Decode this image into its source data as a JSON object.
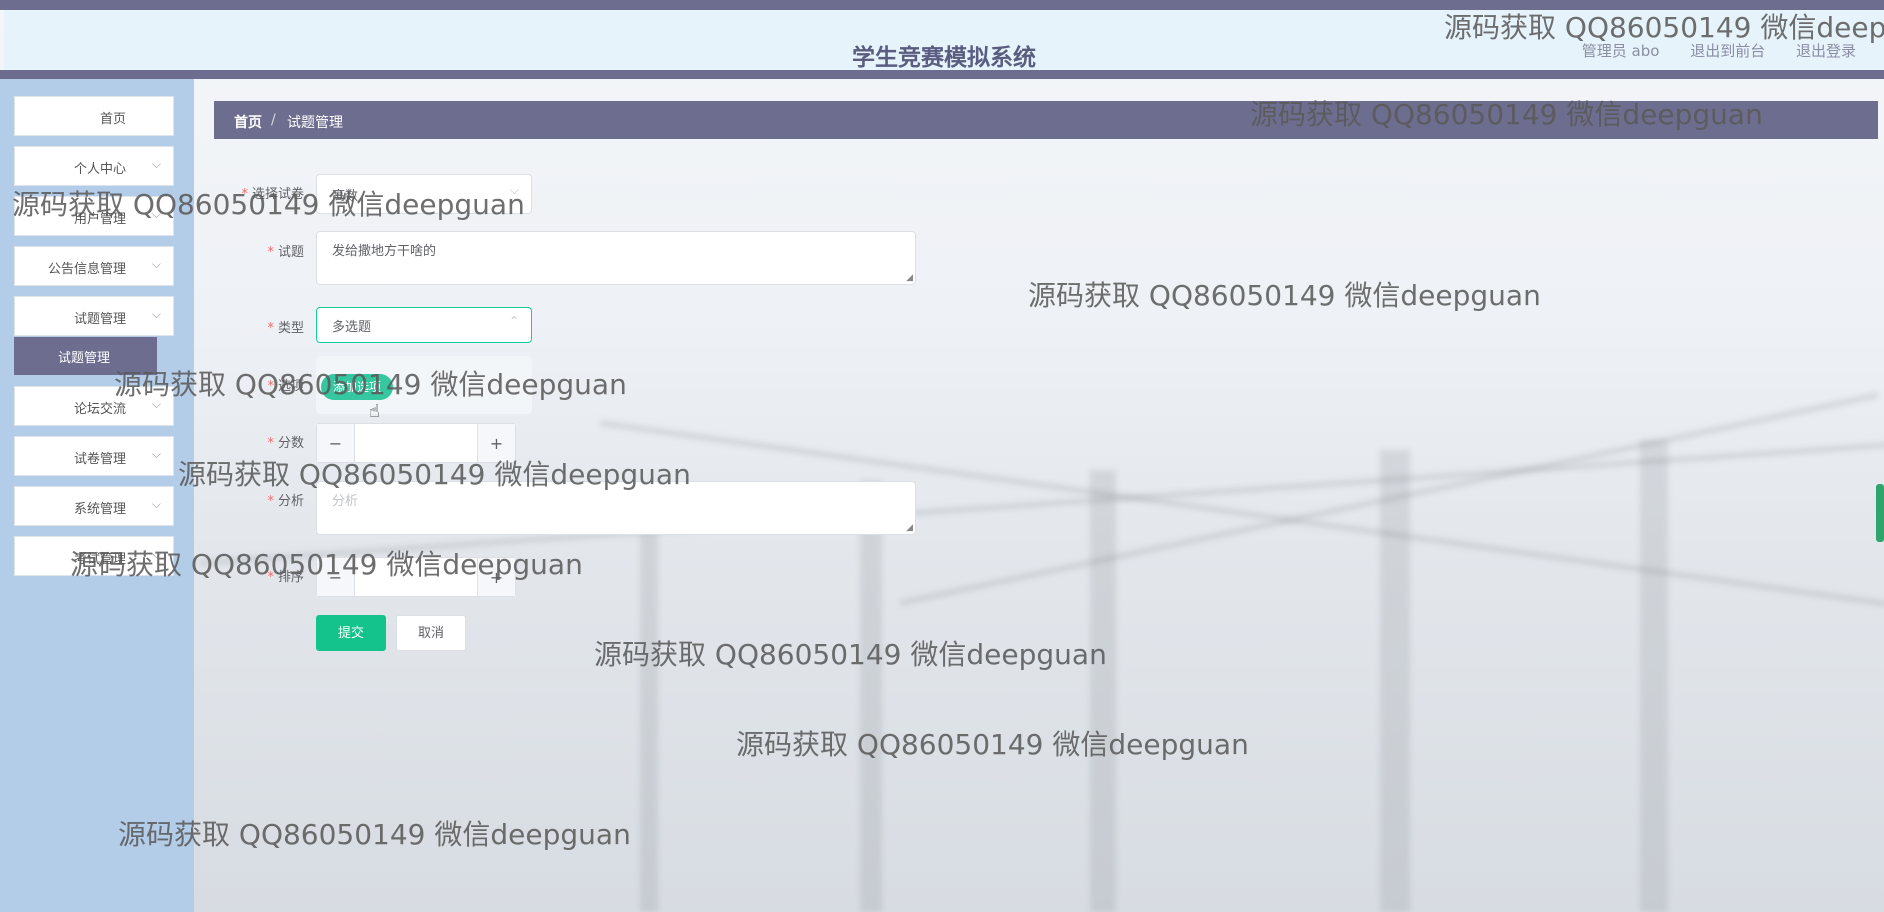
{
  "app": {
    "title": "学生竞赛模拟系统",
    "user_label": "管理员 abo",
    "links": [
      "退出到前台",
      "退出登录"
    ]
  },
  "sidebar": {
    "items": [
      {
        "label": "首页",
        "chevron": false
      },
      {
        "label": "个人中心",
        "chevron": true
      },
      {
        "label": "用户管理",
        "chevron": true
      },
      {
        "label": "公告信息管理",
        "chevron": true
      },
      {
        "label": "试题管理",
        "chevron": true
      },
      {
        "label": "论坛交流",
        "chevron": true
      },
      {
        "label": "试卷管理",
        "chevron": true
      },
      {
        "label": "系统管理",
        "chevron": true
      },
      {
        "label": "考试管理",
        "chevron": true
      }
    ],
    "active_sub": "试题管理"
  },
  "breadcrumb": {
    "home": "首页",
    "separator": "/",
    "current": "试题管理"
  },
  "form": {
    "paper": {
      "label": "选择试卷",
      "value": "高数"
    },
    "question": {
      "label": "试题",
      "value": "发给撒地方干啥的"
    },
    "type": {
      "label": "类型",
      "value": "多选题"
    },
    "options": {
      "label": "选项",
      "button": "添加选项"
    },
    "score": {
      "label": "分数",
      "value": ""
    },
    "analysis": {
      "label": "分析",
      "placeholder": "分析"
    },
    "order": {
      "label": "排序",
      "value": ""
    },
    "submit": "提交",
    "cancel": "取消",
    "accent_color": "#13c38b"
  },
  "watermark": "源码获取 QQ86050149 微信deepguan"
}
